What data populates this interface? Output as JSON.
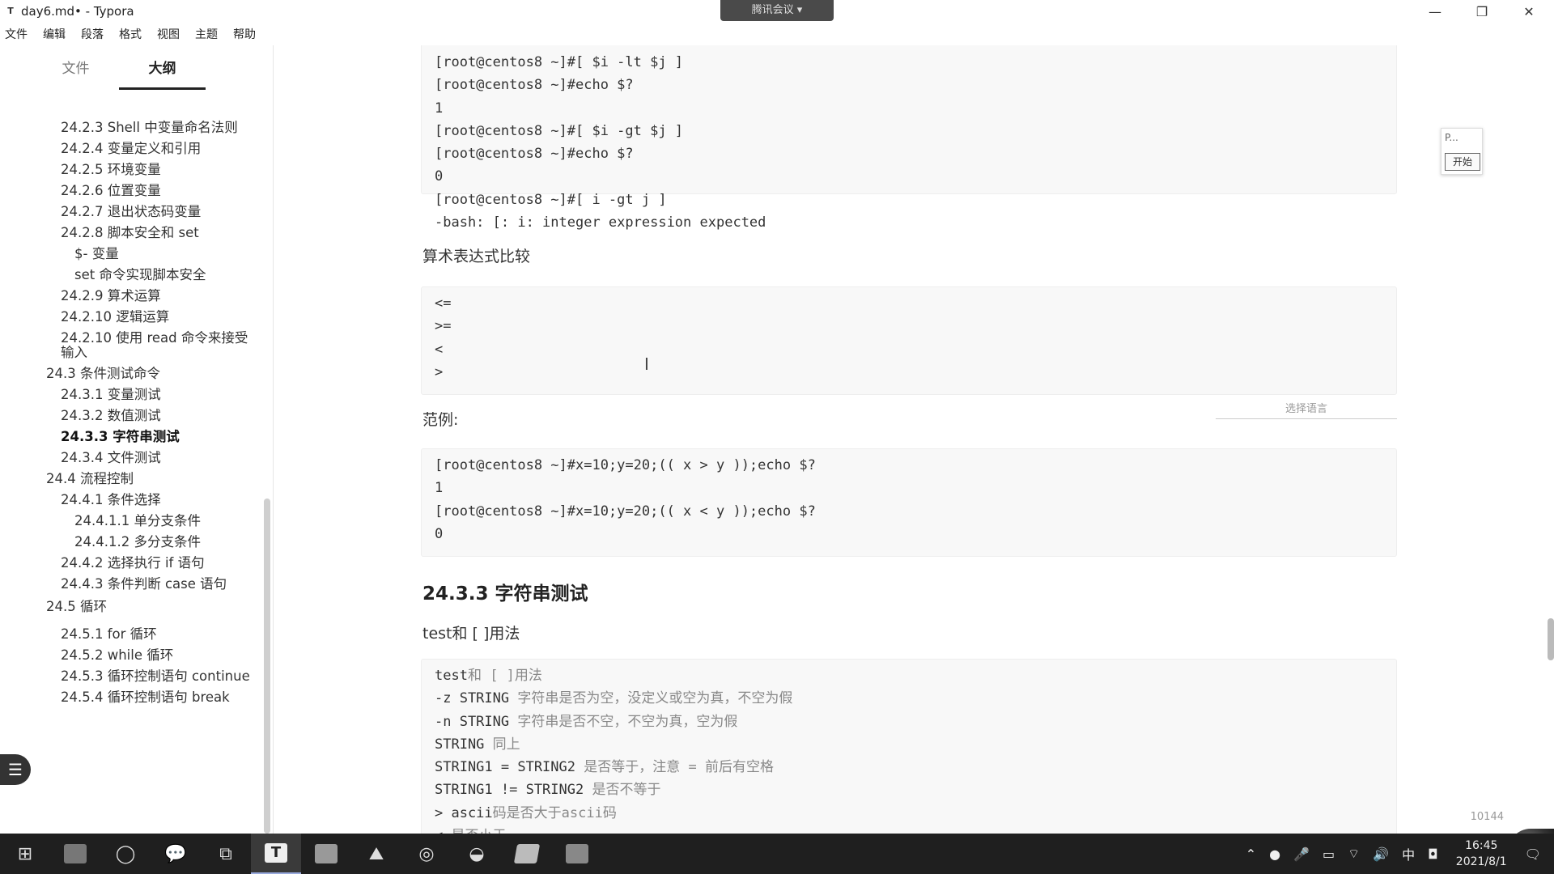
{
  "window": {
    "title": "day6.md• - Typora",
    "app_icon": "T",
    "meeting": "腾讯会议 ▾",
    "minimize": "—",
    "maximize": "❐",
    "close": "✕"
  },
  "menu": [
    "文件",
    "编辑",
    "段落",
    "格式",
    "视图",
    "主题",
    "帮助"
  ],
  "sidebar": {
    "tabs": [
      "文件",
      "大纲"
    ],
    "outline": [
      {
        "text": "24.2.3 Shell 中变量命名法则",
        "level": 1
      },
      {
        "text": "24.2.4 变量定义和引用",
        "level": 1
      },
      {
        "text": "24.2.5 环境变量",
        "level": 1
      },
      {
        "text": "24.2.6 位置变量",
        "level": 1
      },
      {
        "text": "24.2.7 退出状态码变量",
        "level": 1
      },
      {
        "text": "24.2.8 脚本安全和 set",
        "level": 1
      },
      {
        "text": "$- 变量",
        "level": 2
      },
      {
        "text": "set 命令实现脚本安全",
        "level": 2
      },
      {
        "text": "24.2.9 算术运算",
        "level": 1
      },
      {
        "text": "24.2.10 逻辑运算",
        "level": 1
      },
      {
        "text": "24.2.10 使用 read 命令来接受",
        "level": 1
      },
      {
        "text": "输入",
        "level": 1
      },
      {
        "text": "24.3 条件测试命令",
        "level": 0
      },
      {
        "text": "24.3.1 变量测试",
        "level": 1
      },
      {
        "text": "24.3.2 数值测试",
        "level": 1
      },
      {
        "text": "24.3.3 字符串测试",
        "level": 1,
        "active": true
      },
      {
        "text": "24.3.4 文件测试",
        "level": 1
      },
      {
        "text": "24.4 流程控制",
        "level": 0
      },
      {
        "text": "24.4.1 条件选择",
        "level": 1
      },
      {
        "text": "24.4.1.1 单分支条件",
        "level": 2
      },
      {
        "text": "24.4.1.2 多分支条件",
        "level": 2
      },
      {
        "text": "24.4.2 选择执行 if 语句",
        "level": 1
      },
      {
        "text": "24.4.3 条件判断 case 语句",
        "level": 1
      },
      {
        "text": "24.5 循环",
        "level": 0
      },
      {
        "text": "24.5.1 for 循环",
        "level": 1
      },
      {
        "text": "24.5.2 while 循环",
        "level": 1
      },
      {
        "text": "24.5.3 循环控制语句 continue",
        "level": 1
      },
      {
        "text": "24.5.4 循环控制语句 break",
        "level": 1
      }
    ],
    "footer_left": "‹",
    "footer_code": "</>"
  },
  "editor": {
    "code1": [
      "[root@centos8 ~]#[ $i -lt $j ]",
      "[root@centos8 ~]#echo $?",
      "1",
      "[root@centos8 ~]#[ $i -gt $j ]",
      "[root@centos8 ~]#echo $?",
      "0",
      "[root@centos8 ~]#[ i -gt j ]",
      "-bash: [: i: integer expression expected"
    ],
    "p1": "算术表达式比较",
    "code2": [
      "<=",
      ">=",
      "<",
      ">"
    ],
    "lang_select": "选择语言",
    "p2": "范例:",
    "code3": [
      "[root@centos8 ~]#x=10;y=20;(( x > y ));echo $?",
      "1",
      "[root@centos8 ~]#x=10;y=20;(( x < y ));echo $?",
      "0"
    ],
    "h3": "24.3.3 字符串测试",
    "p3": "test和 [ ]用法",
    "code4": [
      {
        "code": "test",
        "comment": "和 [ ]用法"
      },
      {
        "code": "-z STRING ",
        "comment": "字符串是否为空，没定义或空为真，不空为假"
      },
      {
        "code": "-n STRING ",
        "comment": "字符串是否不空，不空为真，空为假"
      },
      {
        "code": "STRING ",
        "comment": "同上"
      },
      {
        "code": "STRING1 = STRING2 ",
        "comment": "是否等于，注意 = 前后有空格"
      },
      {
        "code": "STRING1 != STRING2 ",
        "comment": "是否不等于"
      },
      {
        "code": "> ascii",
        "comment": "码是否大于ascii码"
      },
      {
        "code": "< ",
        "comment": "是否小于"
      }
    ],
    "word_count": "10144",
    "mini_label": "P...",
    "mini_button": "开始"
  },
  "taskbar": {
    "items": [
      "start",
      "recorder",
      "circle-app",
      "wechat",
      "copy-app",
      "typora",
      "files",
      "photos",
      "music",
      "spiral-app",
      "notes",
      "recorder2"
    ],
    "typora_letter": "T",
    "ime": "中",
    "time": "16:45",
    "date": "2021/8/1"
  }
}
